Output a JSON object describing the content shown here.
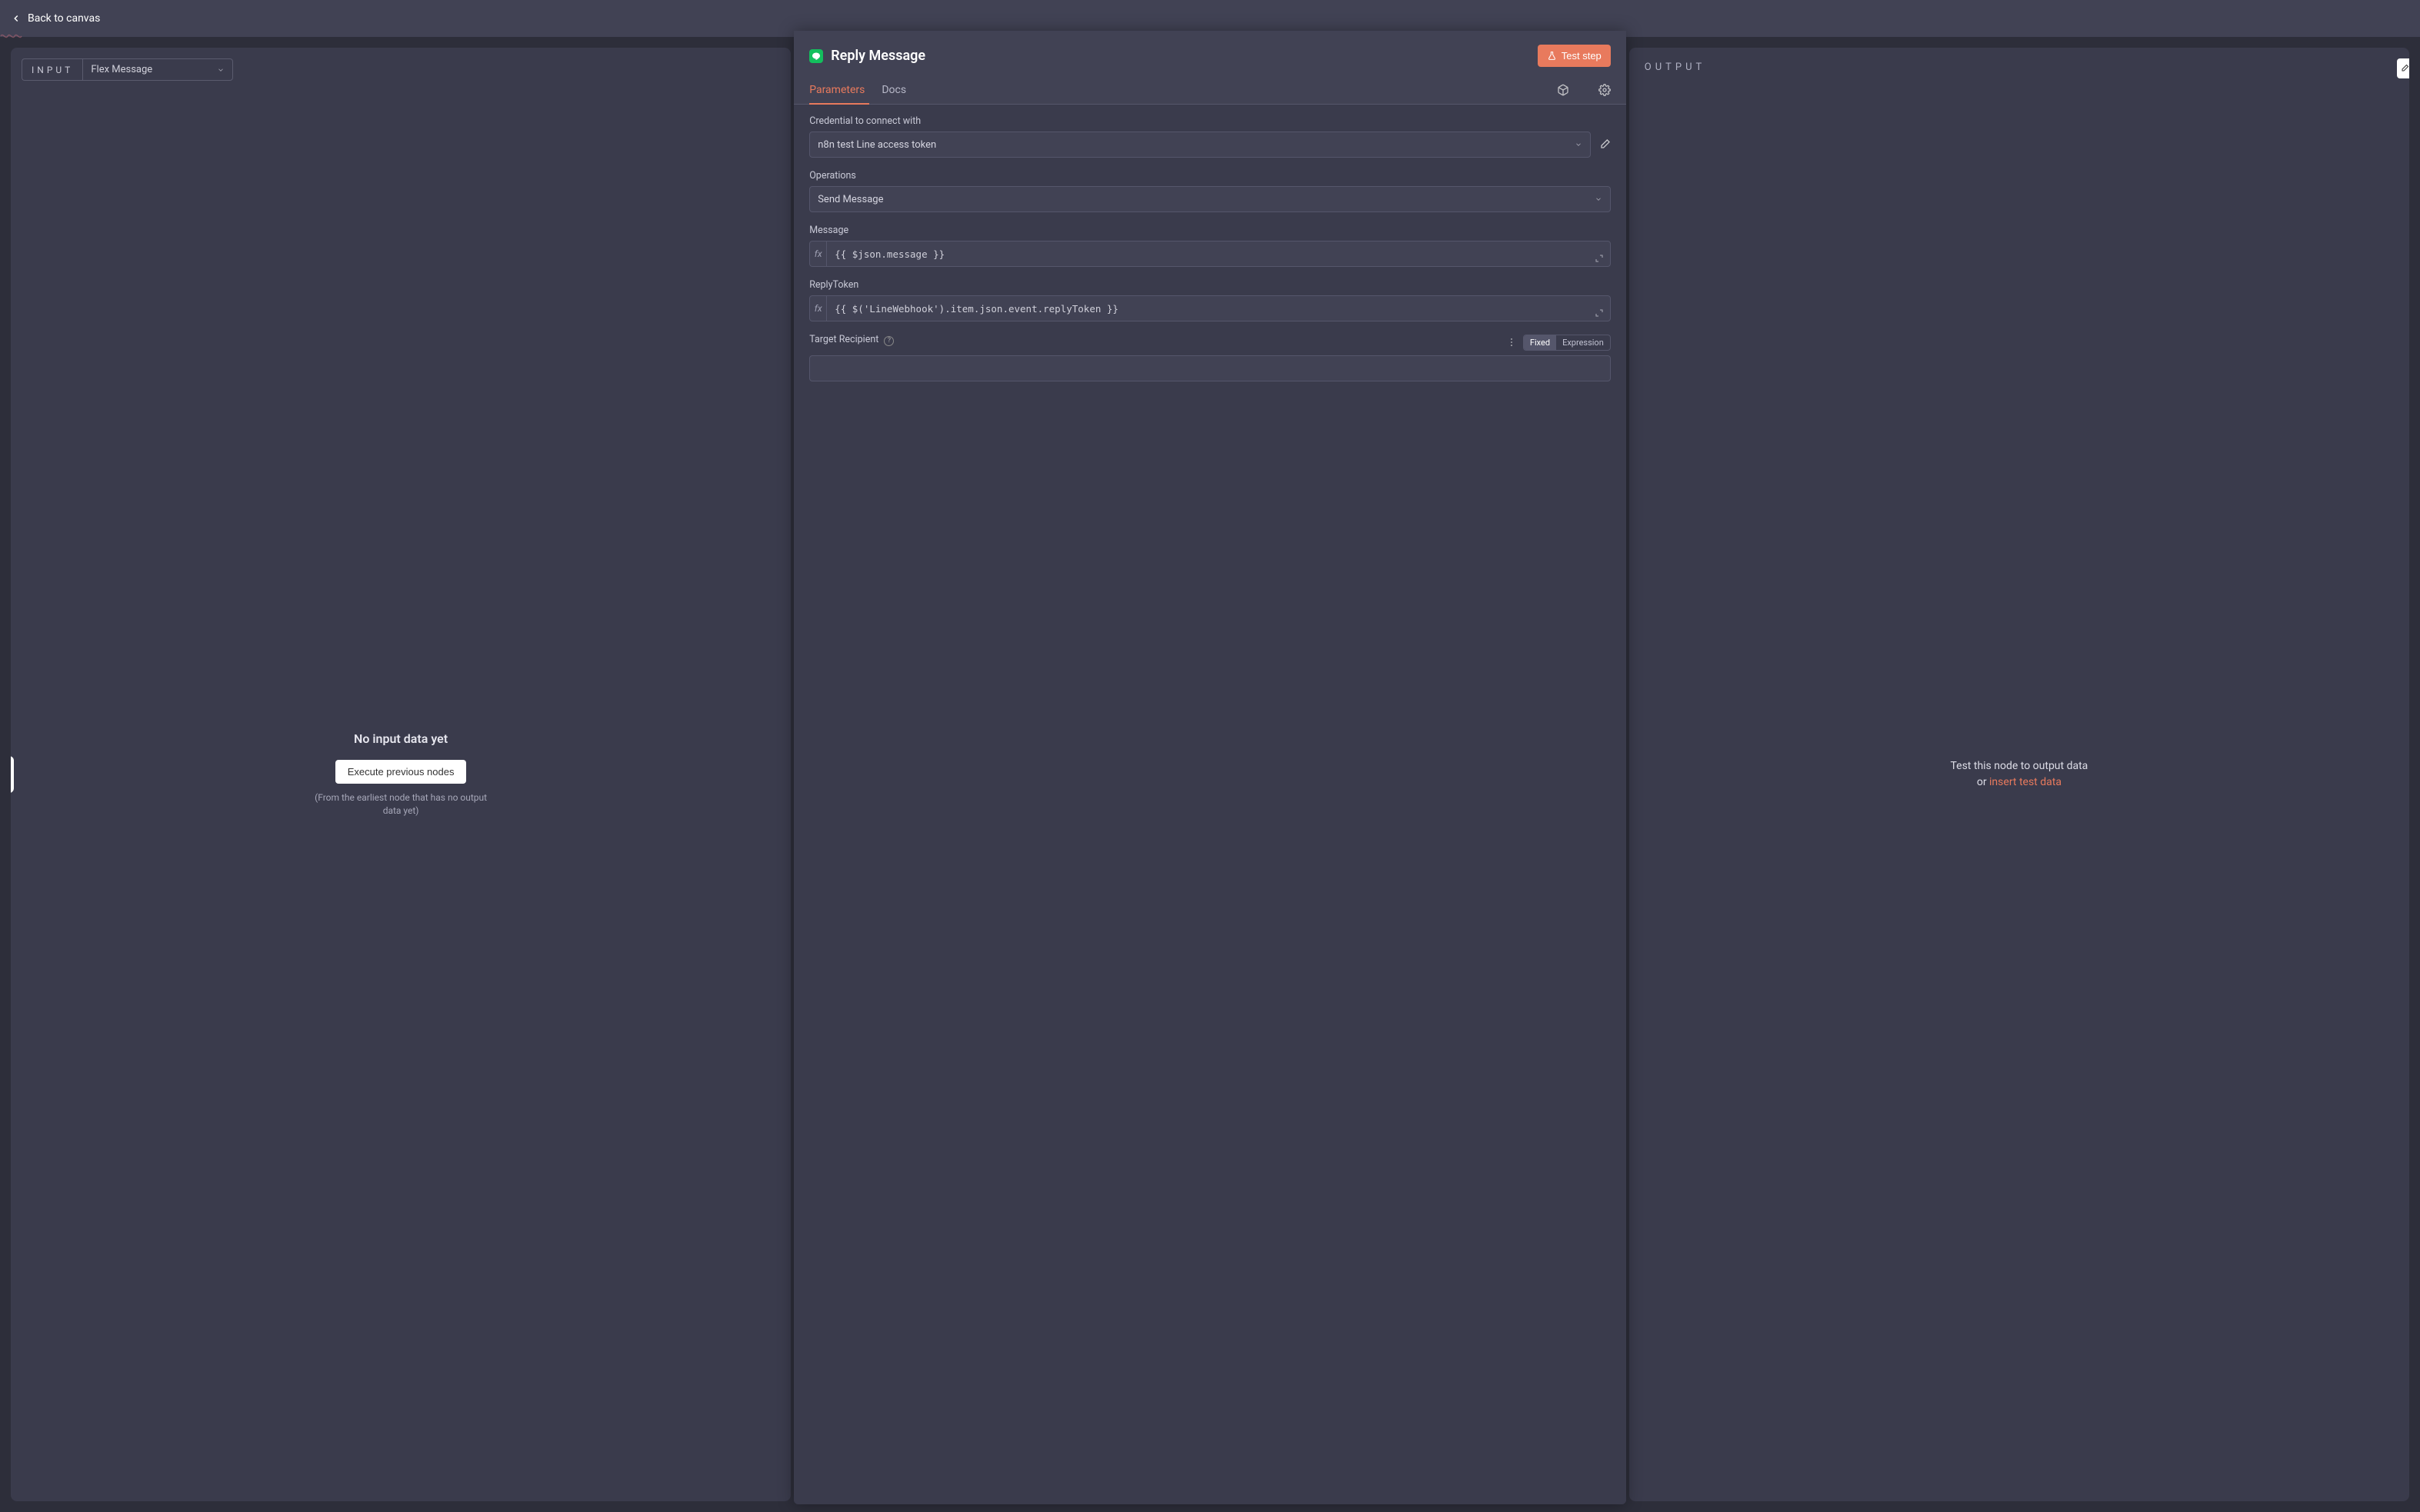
{
  "topbar": {
    "back_label": "Back to canvas"
  },
  "input": {
    "label": "INPUT",
    "source_node": "Flex Message",
    "empty_title": "No input data yet",
    "exec_button": "Execute previous nodes",
    "hint": "(From the earliest node that has no output data yet)"
  },
  "node": {
    "icon_id": "line-logo",
    "title": "Reply Message",
    "test_button": "Test step",
    "tabs": {
      "parameters": "Parameters",
      "docs": "Docs"
    },
    "fields": {
      "credential": {
        "label": "Credential to connect with",
        "value": "n8n test Line access token"
      },
      "operations": {
        "label": "Operations",
        "value": "Send Message"
      },
      "message": {
        "label": "Message",
        "expression": "{{ $json.message }}"
      },
      "reply_token": {
        "label": "ReplyToken",
        "expression": "{{ $('LineWebhook').item.json.event.replyToken }}"
      },
      "target": {
        "label": "Target Recipient",
        "value": "",
        "mode_fixed": "Fixed",
        "mode_expr": "Expression"
      }
    }
  },
  "output": {
    "label": "OUTPUT",
    "line1": "Test this node to output data",
    "or": "or ",
    "link": "insert test data"
  }
}
